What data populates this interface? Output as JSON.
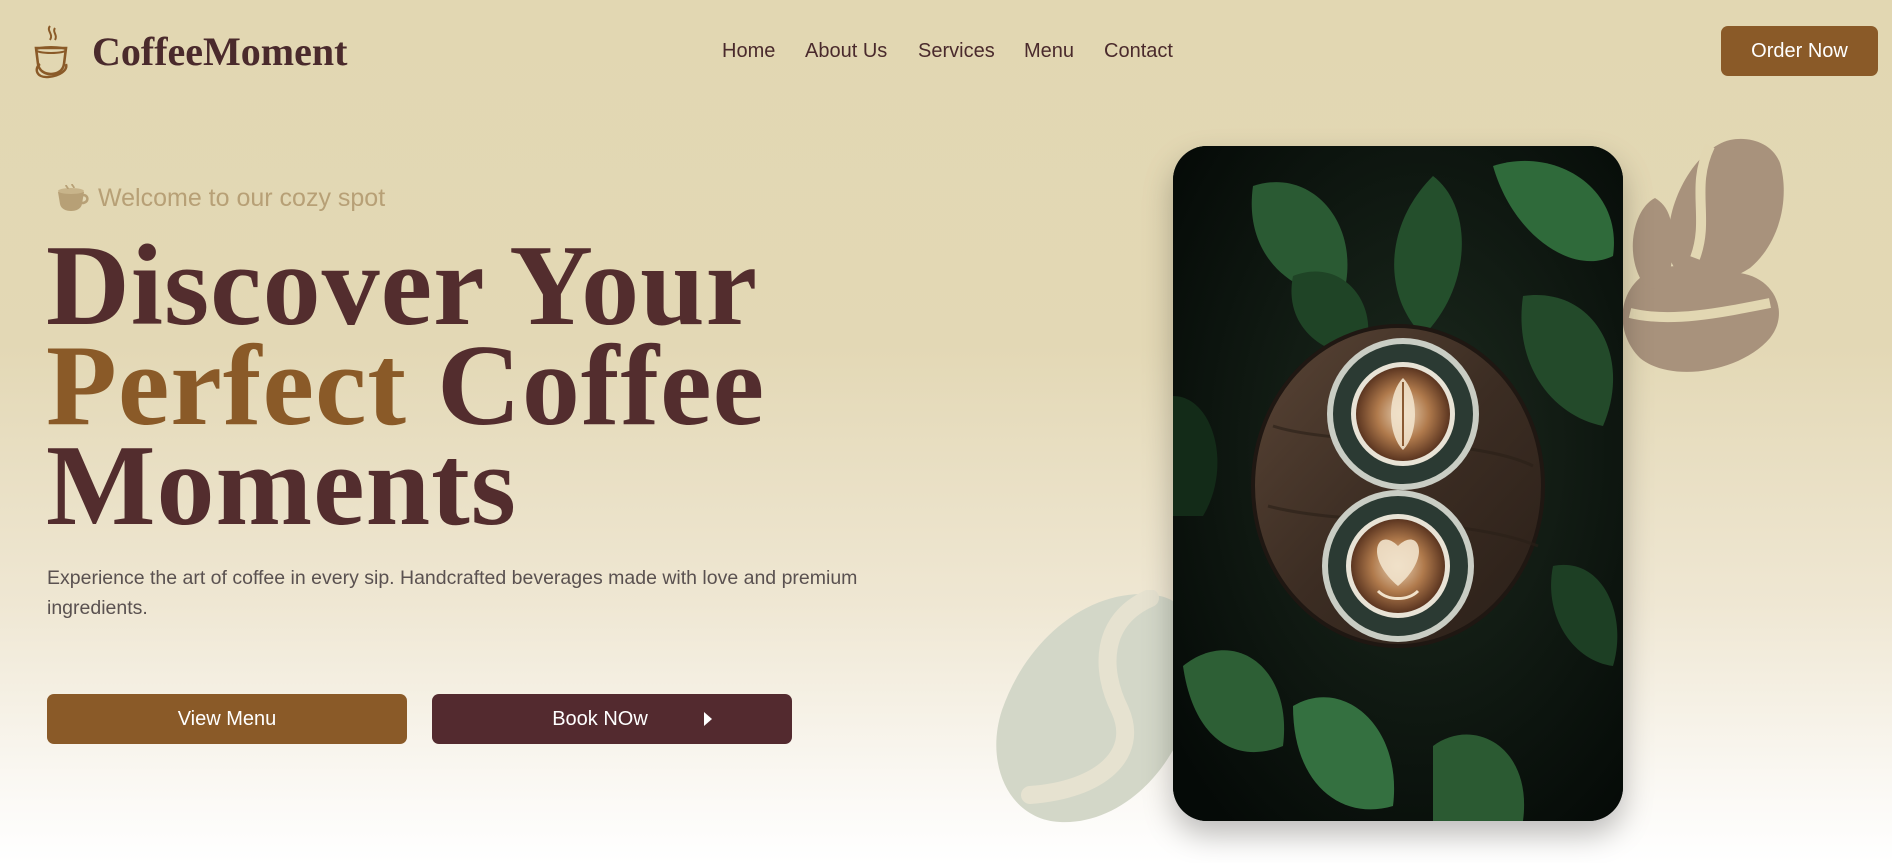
{
  "brand": {
    "name": "CoffeeMoment",
    "logo_icon": "coffee-cup-steam-icon"
  },
  "nav": {
    "items": [
      "Home",
      "About Us",
      "Services",
      "Menu",
      "Contact"
    ]
  },
  "header": {
    "order_label": "Order Now"
  },
  "hero": {
    "welcome_icon": "coffee-cup-icon",
    "welcome_text": "Welcome to our cozy spot",
    "title_line1": "Discover Your",
    "title_accent": "Perfect",
    "title_line2_rest": " Coffee",
    "title_line3": "Moments",
    "description": "Experience the art of coffee in every sip. Handcrafted beverages made with love and premium ingredients.",
    "view_menu_label": "View Menu",
    "book_label": "Book NOw",
    "book_icon": "play-arrow-icon"
  },
  "colors": {
    "primary": "#8a5a28",
    "dark": "#532d2e",
    "background": "#e2d7b2"
  }
}
